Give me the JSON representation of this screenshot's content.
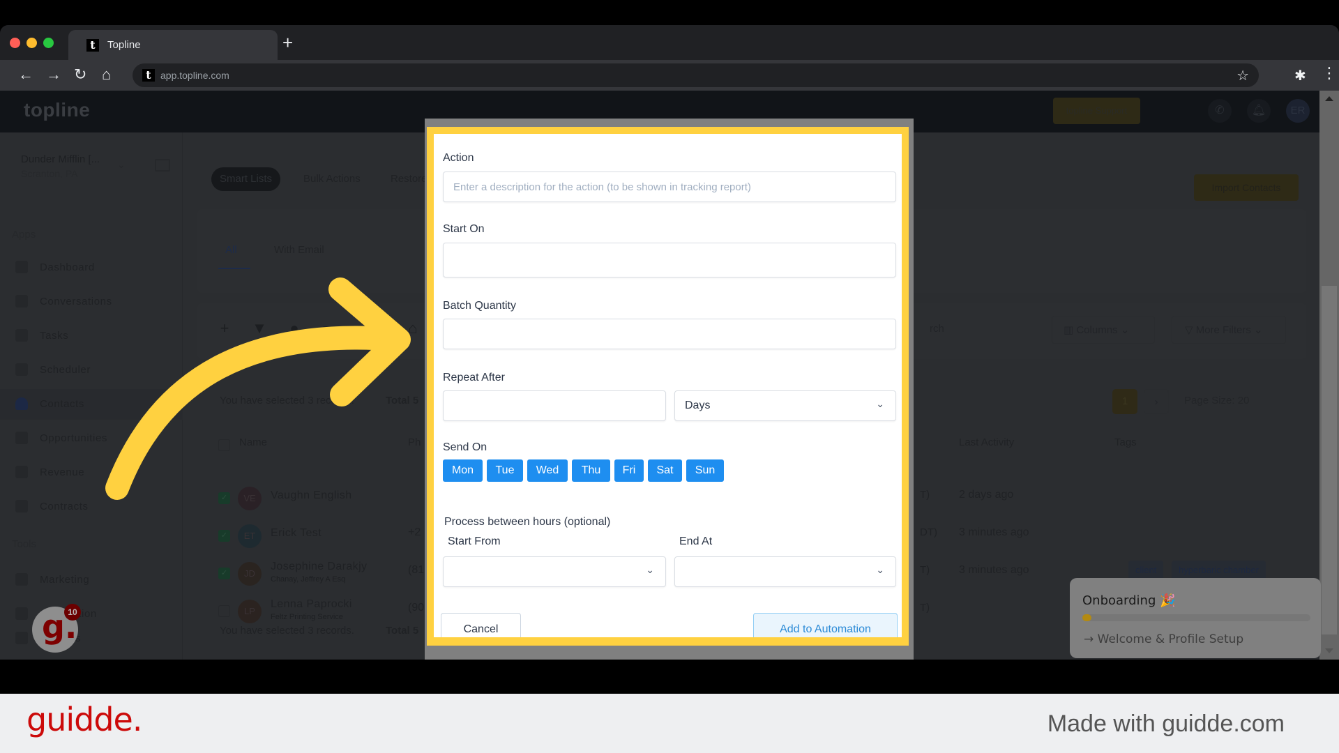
{
  "browser": {
    "tab_title": "Topline",
    "tab_favicon": "t",
    "new_tab": "+",
    "url": "app.topline.com",
    "icons": {
      "back": "arrow-left-icon",
      "forward": "arrow-right-icon",
      "reload": "reload-icon",
      "home": "home-icon",
      "bookmark": "star-icon",
      "extensions": "puzzle-icon",
      "menu": "kebab-icon"
    }
  },
  "app": {
    "logo": "topline",
    "support_button": "topline Support",
    "avatar_initials": "ER",
    "account": {
      "name": "Dunder Mifflin [...",
      "location": "Scranton, PA"
    },
    "sidebar": {
      "section_apps": "Apps",
      "section_tools": "Tools",
      "apps": [
        {
          "label": "Dashboard",
          "icon": "dashboard-icon"
        },
        {
          "label": "Conversations",
          "icon": "chat-icon"
        },
        {
          "label": "Tasks",
          "icon": "tasks-icon"
        },
        {
          "label": "Scheduler",
          "icon": "calendar-icon"
        },
        {
          "label": "Contacts",
          "icon": "person-icon",
          "active": true
        },
        {
          "label": "Opportunities",
          "icon": "target-icon"
        },
        {
          "label": "Revenue",
          "icon": "card-icon"
        },
        {
          "label": "Contracts",
          "icon": "document-icon"
        }
      ],
      "tools": [
        {
          "label": "Marketing",
          "icon": "megaphone-icon"
        },
        {
          "label": "Automation",
          "icon": "gears-icon"
        },
        {
          "label": "Settings",
          "icon": "settings-icon"
        }
      ]
    },
    "top_tabs": [
      "Smart Lists",
      "Bulk Actions",
      "Restore"
    ],
    "list_tabs": [
      "All",
      "With Email"
    ],
    "import_button": "Import Contacts",
    "toolbar": {
      "search_fragment": "rch",
      "columns_button": "Columns",
      "more_filters_button": "More Filters"
    },
    "selection_info": "You have selected 3 records.",
    "total_prefix": "Total 5",
    "pagination": {
      "current_page": "1",
      "next": "›",
      "page_size": "Page Size: 20"
    },
    "table": {
      "columns": [
        "Name",
        "Ph",
        "Last Activity",
        "Tags"
      ],
      "rows": [
        {
          "initials": "VE",
          "name": "Vaughn English",
          "company": "",
          "phone": "",
          "tz": "T)",
          "last_activity": "2 days ago",
          "tags": [],
          "selected": true,
          "avatar_color": "#2a2126"
        },
        {
          "initials": "ET",
          "name": "Erick Test",
          "company": "",
          "phone": "+2",
          "tz": "DT)",
          "last_activity": "3 minutes ago",
          "tags": [],
          "selected": true,
          "avatar_color": "#1e2a30"
        },
        {
          "initials": "JD",
          "name": "Josephine Darakjy",
          "company": "Chanay, Jeffrey A Esq",
          "phone": "(81",
          "tz": "T)",
          "last_activity": "3 minutes ago",
          "tags": [
            "client",
            "hyperbaric chamber"
          ],
          "selected": true,
          "avatar_color": "#2a2420"
        },
        {
          "initials": "LP",
          "name": "Lenna Paprocki",
          "company": "Feltz Printing Service",
          "phone": "(90",
          "tz": "T)",
          "last_activity": "",
          "tags": [],
          "selected": false,
          "avatar_color": "#2b2320"
        }
      ]
    }
  },
  "modal": {
    "action_label": "Action",
    "action_placeholder": "Enter a description for the action (to be shown in tracking report)",
    "action_value": "",
    "start_on_label": "Start On",
    "start_on_value": "",
    "batch_quantity_label": "Batch Quantity",
    "batch_quantity_value": "",
    "repeat_after_label": "Repeat After",
    "repeat_after_value": "",
    "repeat_unit": "Days",
    "send_on_label": "Send On",
    "days": [
      "Mon",
      "Tue",
      "Wed",
      "Thu",
      "Fri",
      "Sat",
      "Sun"
    ],
    "day_color": "#1e8ef0",
    "process_hours_label": "Process between hours (optional)",
    "start_from_label": "Start From",
    "start_from_value": "",
    "end_at_label": "End At",
    "end_at_value": "",
    "cancel_button": "Cancel",
    "submit_button": "Add to Automation",
    "highlight_color": "#ffd140"
  },
  "onboarding": {
    "title": "Onboarding 🎉",
    "progress_fraction": 0.03,
    "step": "→ Welcome & Profile Setup"
  },
  "guidde": {
    "bubble_letter": "g.",
    "badge_count": "10",
    "brand": "guidde.",
    "made_with": "Made with guidde.com"
  }
}
